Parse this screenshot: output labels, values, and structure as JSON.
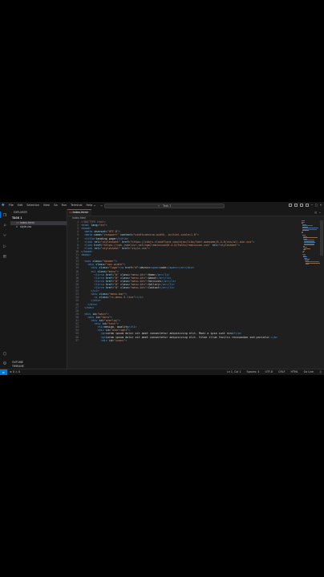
{
  "window": {
    "menus": [
      "File",
      "Edit",
      "Selection",
      "View",
      "Go",
      "Run",
      "Terminal",
      "Help"
    ],
    "search_text": "Task 1"
  },
  "sidebar": {
    "header": "EXPLORER",
    "section": "TASK 1",
    "files": [
      {
        "name": "index.html",
        "type": "html",
        "selected": true
      },
      {
        "name": "style.css",
        "type": "css",
        "selected": false
      }
    ],
    "outline": "OUTLINE",
    "timeline": "TIMELINE"
  },
  "tab": {
    "label": "index.html"
  },
  "breadcrumb": "index.html",
  "editor": {
    "lines": [
      {
        "n": "1",
        "indent": 0,
        "html": "<span class='cm'>&lt;!DOCTYPE html&gt;</span>"
      },
      {
        "n": "2",
        "indent": 0,
        "html": "<span class='tg'>&lt;html</span> <span class='at'>lang</span>=<span class='st'>\"en\"</span><span class='tg'>&gt;</span>"
      },
      {
        "n": "3",
        "indent": 0,
        "html": "<span class='tg'>&lt;head&gt;</span>"
      },
      {
        "n": "4",
        "indent": 2,
        "html": "<span class='tg'>&lt;meta</span> <span class='at'>charset</span>=<span class='st'>\"UTF-8\"</span><span class='tg'>&gt;</span>"
      },
      {
        "n": "5",
        "indent": 2,
        "html": "<span class='tg'>&lt;meta</span> <span class='at'>name</span>=<span class='st'>\"viewport\"</span> <span class='at'>content</span>=<span class='st'>\"width=device-width, initial-scale=1.0\"</span><span class='tg'>&gt;</span>"
      },
      {
        "n": "6",
        "indent": 2,
        "html": "<span class='tg'>&lt;title&gt;</span><span class='tx'>landing page</span><span class='tg'>&lt;/title&gt;</span>"
      },
      {
        "n": "7",
        "indent": 2,
        "html": "<span class='tg'>&lt;link</span> <span class='at'>rel</span>=<span class='st'>\"stylesheet\"</span> <span class='at'>href</span>=<span class='st'>\"https://cdnjs.cloudflare.com/ajax/libs/font-awesome/6.4.0/css/all.min.css\"</span><span class='tg'>&gt;</span>"
      },
      {
        "n": "8",
        "indent": 2,
        "html": "<span class='tg'>&lt;link</span> <span class='at'>href</span>=<span class='st'>\"https://cdn.jsdelivr.net/npm/remixicon@3.4.0/fonts/remixicon.css\"</span> <span class='at'>rel</span>=<span class='st'>\"stylesheet\"</span><span class='tg'>&gt;</span>"
      },
      {
        "n": "9",
        "indent": 2,
        "html": "<span class='tg'>&lt;link</span> <span class='at'>rel</span>=<span class='st'>\"stylesheet\"</span> <span class='at'>href</span>=<span class='st'>\"style.css\"</span><span class='tg'>&gt;</span>"
      },
      {
        "n": "10",
        "indent": 0,
        "html": "<span class='tg'>&lt;/head&gt;</span>"
      },
      {
        "n": "11",
        "indent": 0,
        "html": "<span class='tg'>&lt;body&gt;</span>"
      },
      {
        "n": "12",
        "indent": 0,
        "html": ""
      },
      {
        "n": "13",
        "indent": 2,
        "html": "<span class='tg'>&lt;nav</span> <span class='at'>class</span>=<span class='st'>\"header\"</span><span class='tg'>&gt;</span>"
      },
      {
        "n": "14",
        "indent": 4,
        "html": "<span class='tg'>&lt;div</span> <span class='at'>class</span>=<span class='st'>\"nav-width\"</span><span class='tg'>&gt;</span>"
      },
      {
        "n": "15",
        "indent": 6,
        "html": "<span class='tg'>&lt;div</span> <span class='at'>class</span>=<span class='st'>\"logo\"</span><span class='tg'>&gt;&lt;a</span> <span class='at'>href</span>=<span class='st'>\"#\"</span><span class='tg'>&gt;</span><span class='tx'>devsin</span><span class='tg'>&lt;span&gt;</span><span class='tx'>code</span><span class='tg'>&lt;/span&gt;&lt;/a&gt;&lt;/div&gt;</span>"
      },
      {
        "n": "16",
        "indent": 6,
        "html": "<span class='tg'>&lt;ul</span> <span class='at'>class</span>=<span class='st'>\"menu\"</span><span class='tg'>&gt;</span>"
      },
      {
        "n": "17",
        "indent": 8,
        "html": "<span class='tg'>&lt;li&gt;&lt;a</span> <span class='at'>href</span>=<span class='st'>\"#\"</span> <span class='at'>class</span>=<span class='st'>\"menu-btn\"</span><span class='tg'>&gt;</span><span class='tx'>Home</span><span class='tg'>&lt;/a&gt;&lt;/li&gt;</span>"
      },
      {
        "n": "18",
        "indent": 8,
        "html": "<span class='tg'>&lt;li&gt;&lt;a</span> <span class='at'>href</span>=<span class='st'>\"#\"</span> <span class='at'>class</span>=<span class='st'>\"menu-btn\"</span><span class='tg'>&gt;</span><span class='tx'>About</span><span class='tg'>&lt;/a&gt;&lt;/li&gt;</span>"
      },
      {
        "n": "19",
        "indent": 8,
        "html": "<span class='tg'>&lt;li&gt;&lt;a</span> <span class='at'>href</span>=<span class='st'>\"#\"</span> <span class='at'>class</span>=<span class='st'>\"menu-btn\"</span><span class='tg'>&gt;</span><span class='tx'>Services</span><span class='tg'>&lt;/a&gt;&lt;/li&gt;</span>"
      },
      {
        "n": "20",
        "indent": 8,
        "html": "<span class='tg'>&lt;li&gt;&lt;a</span> <span class='at'>href</span>=<span class='st'>\"#\"</span> <span class='at'>class</span>=<span class='st'>\"menu-btn\"</span><span class='tg'>&gt;</span><span class='tx'>Gallery</span><span class='tg'>&lt;/a&gt;&lt;/li&gt;</span>"
      },
      {
        "n": "21",
        "indent": 8,
        "html": "<span class='tg'>&lt;li&gt;&lt;a</span> <span class='at'>href</span>=<span class='st'>\"#\"</span> <span class='at'>class</span>=<span class='st'>\"menu-btn\"</span><span class='tg'>&gt;</span><span class='tx'>Contact</span><span class='tg'>&lt;/a&gt;&lt;/li&gt;</span>"
      },
      {
        "n": "22",
        "indent": 6,
        "html": "<span class='tg'>&lt;/ul&gt;</span>"
      },
      {
        "n": "23",
        "indent": 6,
        "html": "<span class='tg'>&lt;div</span> <span class='at'>class</span>=<span class='st'>\"menu-bar\"</span><span class='tg'>&gt;</span>"
      },
      {
        "n": "24",
        "indent": 8,
        "html": "<span class='tg'>&lt;i</span> <span class='at'>class</span>=<span class='st'>\"ri-menu-3-line\"</span><span class='tg'>&gt;&lt;/i&gt;</span>"
      },
      {
        "n": "25",
        "indent": 6,
        "html": "<span class='tg'>&lt;/div&gt;</span>"
      },
      {
        "n": "26",
        "indent": 4,
        "html": "<span class='tg'>&lt;/div&gt;</span>"
      },
      {
        "n": "27",
        "indent": 2,
        "html": "<span class='tg'>&lt;/nav&gt;</span>"
      },
      {
        "n": "28",
        "indent": 0,
        "html": ""
      },
      {
        "n": "29",
        "indent": 2,
        "html": "<span class='tg'>&lt;div</span> <span class='at'>id</span>=<span class='st'>\"main\"</span><span class='tg'>&gt;</span>"
      },
      {
        "n": "30",
        "indent": 4,
        "html": "<span class='tg'>&lt;div</span> <span class='at'>id</span>=<span class='st'>\"hero\"</span><span class='tg'>&gt;</span>"
      },
      {
        "n": "31",
        "indent": 6,
        "html": "<span class='tg'>&lt;div</span> <span class='at'>id</span>=<span class='st'>\"overlay\"</span><span class='tg'>&gt;</span>"
      },
      {
        "n": "32",
        "indent": 8,
        "html": "<span class='tg'>&lt;div</span> <span class='at'>id</span>=<span class='st'>\"text\"</span><span class='tg'>&gt;</span>"
      },
      {
        "n": "33",
        "indent": 10,
        "html": "<span class='tg'>&lt;h1&gt;</span><span class='tx'>design, quality</span><span class='tg'>&lt;/h1&gt;</span>"
      },
      {
        "n": "34",
        "indent": 10,
        "html": "<span class='tg'>&lt;div</span> <span class='at'>id</span>=<span class='st'>\"overright\"</span><span class='tg'>&gt;</span>"
      },
      {
        "n": "35",
        "indent": 12,
        "html": "<span class='tg'>&lt;p&gt;</span><span class='tx'>Lorem ipsum dolor sit amet consectetur adipisicing elit. Modi a ipsa sunt nisi!</span><span class='tg'>&lt;/p&gt;</span>"
      },
      {
        "n": "36",
        "indent": 12,
        "html": "<span class='tg'>&lt;p&gt;</span><span class='tx'>Lorem ipsum dolor sit amet consectetur adipisicing elit. Vitae illum facilis recusandae sed pariatur.</span><span class='tg'>&lt;/p&gt;</span>"
      },
      {
        "n": "37",
        "indent": 12,
        "html": "<span class='tg'>&lt;div</span> <span class='at'>id</span>=<span class='st'>\"icons\"</span><span class='tg'>&gt;</span>"
      }
    ]
  },
  "status": {
    "errors": "0",
    "warnings": "0",
    "position": "Ln 1, Col 1",
    "spaces": "Spaces: 4",
    "encoding": "UTF-8",
    "eol": "CRLF",
    "language": "HTML",
    "golive": "Go Live"
  }
}
